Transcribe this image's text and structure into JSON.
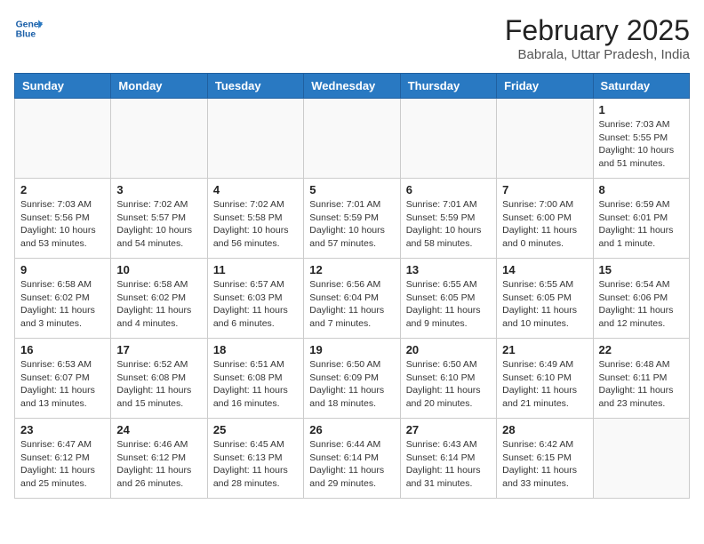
{
  "header": {
    "logo_line1": "General",
    "logo_line2": "Blue",
    "month_year": "February 2025",
    "location": "Babrala, Uttar Pradesh, India"
  },
  "weekdays": [
    "Sunday",
    "Monday",
    "Tuesday",
    "Wednesday",
    "Thursday",
    "Friday",
    "Saturday"
  ],
  "weeks": [
    [
      {
        "day": "",
        "sunrise": "",
        "sunset": "",
        "daylight": ""
      },
      {
        "day": "",
        "sunrise": "",
        "sunset": "",
        "daylight": ""
      },
      {
        "day": "",
        "sunrise": "",
        "sunset": "",
        "daylight": ""
      },
      {
        "day": "",
        "sunrise": "",
        "sunset": "",
        "daylight": ""
      },
      {
        "day": "",
        "sunrise": "",
        "sunset": "",
        "daylight": ""
      },
      {
        "day": "",
        "sunrise": "",
        "sunset": "",
        "daylight": ""
      },
      {
        "day": "1",
        "sunrise": "7:03 AM",
        "sunset": "5:55 PM",
        "daylight": "10 hours and 51 minutes."
      }
    ],
    [
      {
        "day": "2",
        "sunrise": "7:03 AM",
        "sunset": "5:56 PM",
        "daylight": "10 hours and 53 minutes."
      },
      {
        "day": "3",
        "sunrise": "7:02 AM",
        "sunset": "5:57 PM",
        "daylight": "10 hours and 54 minutes."
      },
      {
        "day": "4",
        "sunrise": "7:02 AM",
        "sunset": "5:58 PM",
        "daylight": "10 hours and 56 minutes."
      },
      {
        "day": "5",
        "sunrise": "7:01 AM",
        "sunset": "5:59 PM",
        "daylight": "10 hours and 57 minutes."
      },
      {
        "day": "6",
        "sunrise": "7:01 AM",
        "sunset": "5:59 PM",
        "daylight": "10 hours and 58 minutes."
      },
      {
        "day": "7",
        "sunrise": "7:00 AM",
        "sunset": "6:00 PM",
        "daylight": "11 hours and 0 minutes."
      },
      {
        "day": "8",
        "sunrise": "6:59 AM",
        "sunset": "6:01 PM",
        "daylight": "11 hours and 1 minute."
      }
    ],
    [
      {
        "day": "9",
        "sunrise": "6:58 AM",
        "sunset": "6:02 PM",
        "daylight": "11 hours and 3 minutes."
      },
      {
        "day": "10",
        "sunrise": "6:58 AM",
        "sunset": "6:02 PM",
        "daylight": "11 hours and 4 minutes."
      },
      {
        "day": "11",
        "sunrise": "6:57 AM",
        "sunset": "6:03 PM",
        "daylight": "11 hours and 6 minutes."
      },
      {
        "day": "12",
        "sunrise": "6:56 AM",
        "sunset": "6:04 PM",
        "daylight": "11 hours and 7 minutes."
      },
      {
        "day": "13",
        "sunrise": "6:55 AM",
        "sunset": "6:05 PM",
        "daylight": "11 hours and 9 minutes."
      },
      {
        "day": "14",
        "sunrise": "6:55 AM",
        "sunset": "6:05 PM",
        "daylight": "11 hours and 10 minutes."
      },
      {
        "day": "15",
        "sunrise": "6:54 AM",
        "sunset": "6:06 PM",
        "daylight": "11 hours and 12 minutes."
      }
    ],
    [
      {
        "day": "16",
        "sunrise": "6:53 AM",
        "sunset": "6:07 PM",
        "daylight": "11 hours and 13 minutes."
      },
      {
        "day": "17",
        "sunrise": "6:52 AM",
        "sunset": "6:08 PM",
        "daylight": "11 hours and 15 minutes."
      },
      {
        "day": "18",
        "sunrise": "6:51 AM",
        "sunset": "6:08 PM",
        "daylight": "11 hours and 16 minutes."
      },
      {
        "day": "19",
        "sunrise": "6:50 AM",
        "sunset": "6:09 PM",
        "daylight": "11 hours and 18 minutes."
      },
      {
        "day": "20",
        "sunrise": "6:50 AM",
        "sunset": "6:10 PM",
        "daylight": "11 hours and 20 minutes."
      },
      {
        "day": "21",
        "sunrise": "6:49 AM",
        "sunset": "6:10 PM",
        "daylight": "11 hours and 21 minutes."
      },
      {
        "day": "22",
        "sunrise": "6:48 AM",
        "sunset": "6:11 PM",
        "daylight": "11 hours and 23 minutes."
      }
    ],
    [
      {
        "day": "23",
        "sunrise": "6:47 AM",
        "sunset": "6:12 PM",
        "daylight": "11 hours and 25 minutes."
      },
      {
        "day": "24",
        "sunrise": "6:46 AM",
        "sunset": "6:12 PM",
        "daylight": "11 hours and 26 minutes."
      },
      {
        "day": "25",
        "sunrise": "6:45 AM",
        "sunset": "6:13 PM",
        "daylight": "11 hours and 28 minutes."
      },
      {
        "day": "26",
        "sunrise": "6:44 AM",
        "sunset": "6:14 PM",
        "daylight": "11 hours and 29 minutes."
      },
      {
        "day": "27",
        "sunrise": "6:43 AM",
        "sunset": "6:14 PM",
        "daylight": "11 hours and 31 minutes."
      },
      {
        "day": "28",
        "sunrise": "6:42 AM",
        "sunset": "6:15 PM",
        "daylight": "11 hours and 33 minutes."
      },
      {
        "day": "",
        "sunrise": "",
        "sunset": "",
        "daylight": ""
      }
    ]
  ]
}
